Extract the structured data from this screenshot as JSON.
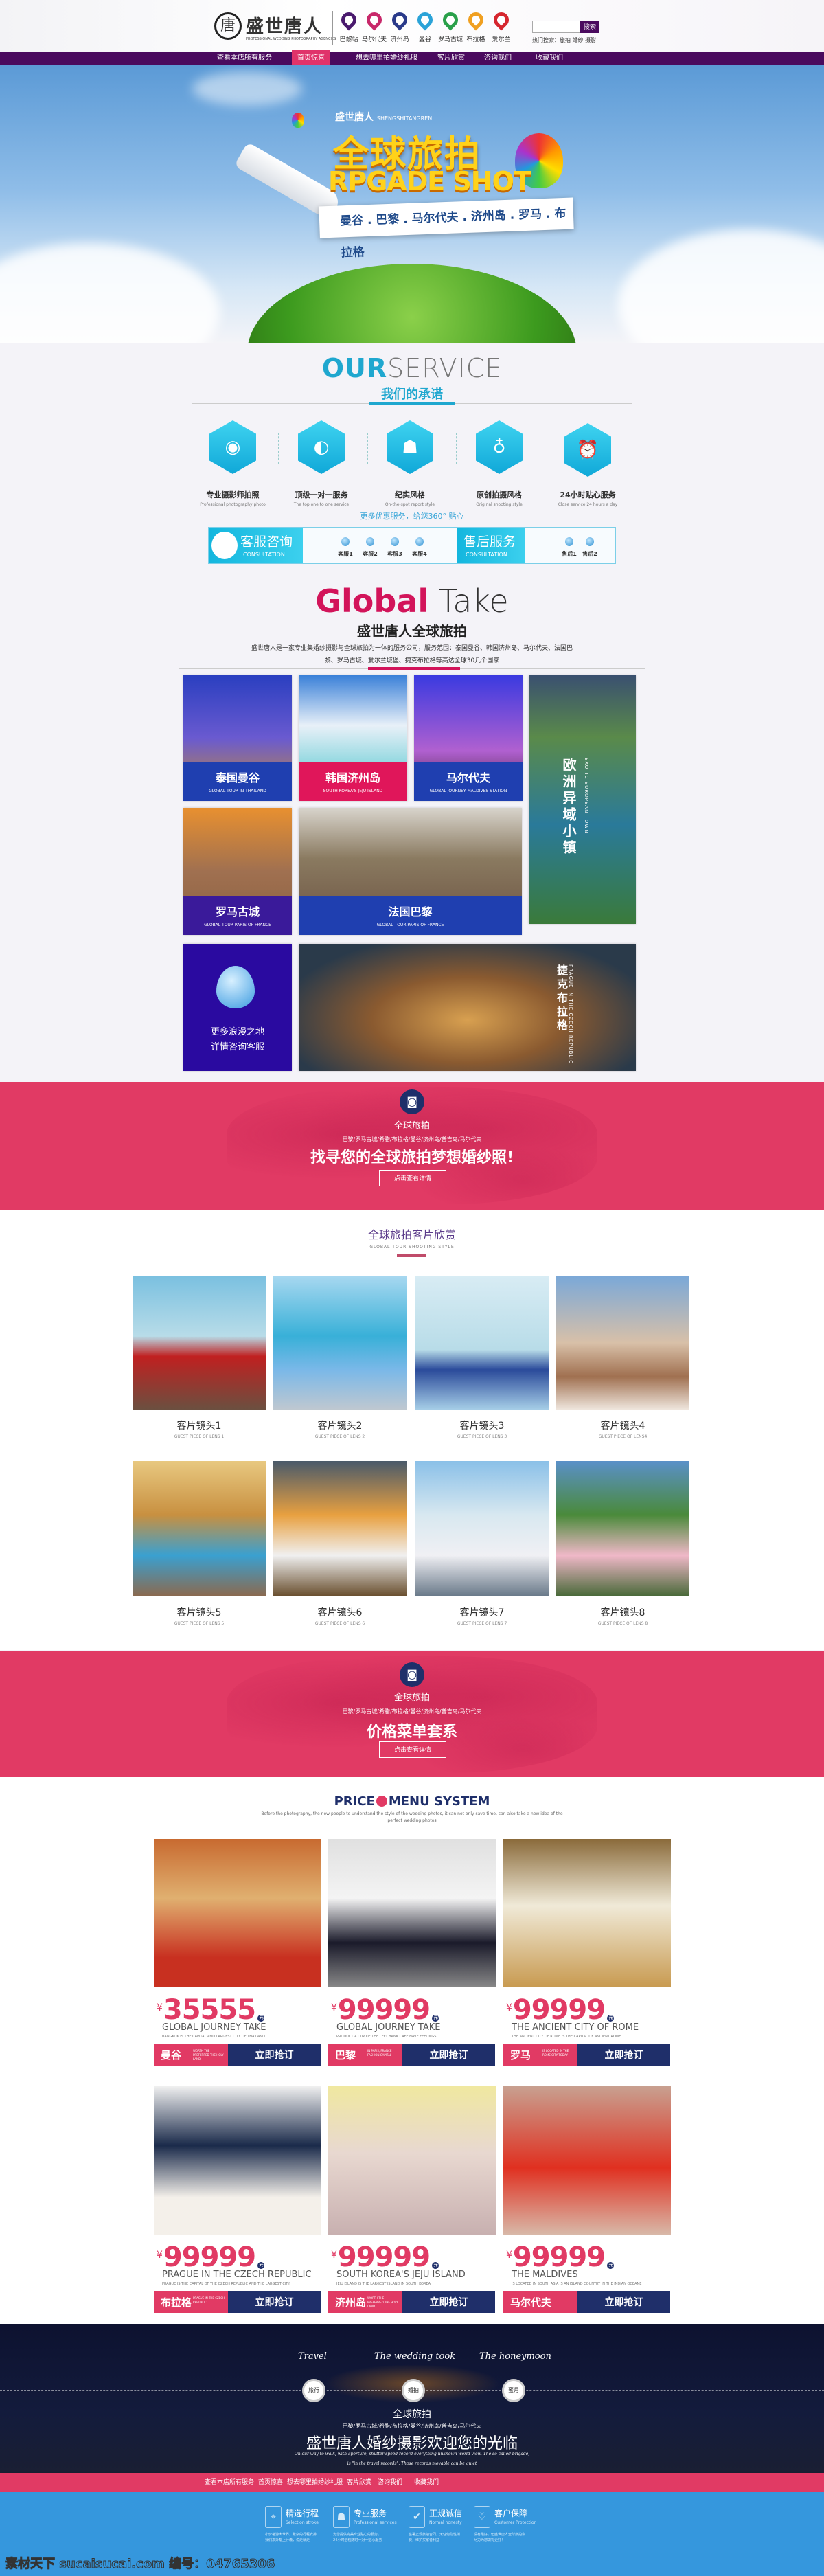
{
  "colors": {
    "brand_purple": "#4a0a5e",
    "accent_pink": "#e13a64",
    "navy": "#1f2f6a",
    "cyan": "#1fb8e0",
    "footer_blue": "#3597dd"
  },
  "header": {
    "logo_mark": "唐",
    "logo_text": "盛世唐人",
    "logo_sub": "PROFESSIONAL WEDDING PHOTOGRAPHY AGENCIES",
    "pins": [
      {
        "label": "巴黎站",
        "color": "#4a1a6e"
      },
      {
        "label": "马尔代夫",
        "color": "#c8286a"
      },
      {
        "label": "济州岛",
        "color": "#2a3a8a"
      },
      {
        "label": "曼谷",
        "color": "#2ba3d8"
      },
      {
        "label": "罗马古城",
        "color": "#2aa04a"
      },
      {
        "label": "布拉格",
        "color": "#f0a020"
      },
      {
        "label": "爱尔兰",
        "color": "#d6262e"
      }
    ],
    "search": {
      "value": "",
      "button": "搜索"
    },
    "hot_search": "热门搜索：旅拍  婚纱  摄影"
  },
  "nav": {
    "items": [
      "查看本店所有服务",
      "首页惊喜",
      "想去哪里拍婚纱礼服",
      "客片欣赏",
      "咨询我们",
      "收藏我们"
    ],
    "active": 1
  },
  "hero": {
    "brand": "盛世唐人",
    "brand_en": "SHENGSHITANGREN",
    "title": "全球旅拍",
    "title_en": "RPGADE SHOT",
    "destinations": "曼谷 . 巴黎 . 马尔代夫 . 济州岛 . 罗马 . 布拉格"
  },
  "service": {
    "title_bold": "OUR",
    "title_light": "SERVICE",
    "subtitle": "我们的承诺",
    "items": [
      {
        "icon": "camera",
        "label": "专业摄影师拍照",
        "en": "Professional photography photo"
      },
      {
        "icon": "hand-egg",
        "label": "顶级一对一服务",
        "en": "The top one to one service"
      },
      {
        "icon": "person-camera",
        "label": "纪实风格",
        "en": "On-the-spot report style"
      },
      {
        "icon": "lightbulb",
        "label": "原创拍摄风格",
        "en": "Original shooting style"
      },
      {
        "icon": "clock",
        "label": "24小时贴心服务",
        "en": "Close service 24 hours a day"
      }
    ],
    "more": "更多优惠服务，给您360° 贴心",
    "consult": {
      "title": "客服咨询",
      "en": "CONSULTATION",
      "agents": [
        "客服1",
        "客服2",
        "客服3",
        "客服4"
      ]
    },
    "after_sales": {
      "title": "售后服务",
      "en": "CONSULTATION",
      "agents": [
        "售后1",
        "售后2"
      ]
    }
  },
  "global": {
    "title_bold": "Global",
    "title_light": "Take",
    "subtitle": "盛世唐人全球旅拍",
    "desc": "盛世唐人是一家专业集婚纱摄影与全球旅拍为一体的服务公司，服务范围：泰国曼谷、韩国济州岛、马尔代夫、法国巴黎、罗马古城、爱尔兰城堡、捷克布拉格等高达全球30几个国家",
    "tiles": [
      {
        "zh": "泰国曼谷",
        "en": "GLOBAL TOUR IN THAILAND",
        "band": "#1f3fb0"
      },
      {
        "zh": "韩国济州岛",
        "en": "SOUTH KOREA'S JEJU ISLAND",
        "band": "#e0165a"
      },
      {
        "zh": "马尔代夫",
        "en": "GLOBAL JOURNEY MALDIVES STATION",
        "band": "#1f3fb0"
      },
      {
        "zh": "欧洲异域小镇",
        "en": "EXOTIC EUROPEAN TOWN"
      },
      {
        "zh": "罗马古城",
        "en": "GLOBAL TOUR PARIS OF FRANCE",
        "band": "#3a1a9a"
      },
      {
        "zh": "法国巴黎",
        "en": "GLOBAL TOUR PARIS OF FRANCE",
        "band": "#1f3fb0"
      },
      {
        "zh1": "更多浪漫之地",
        "zh2": "详情咨询客服"
      },
      {
        "zh": "捷克布拉格",
        "en": "PRAGUE IN THE CZECH REPUBLIC"
      }
    ]
  },
  "banner1": {
    "small": "全球旅拍",
    "cities": "巴黎/罗马古城/希腊/布拉格/曼谷/济州岛/普吉岛/马尔代夫",
    "big": "找寻您的全球旅拍梦想婚纱照!",
    "button": "点击查看详情"
  },
  "guest": {
    "title": "全球旅拍客片欣赏",
    "en": "GLOBAL TOUR SHOOTING STYLE",
    "items": [
      {
        "label": "客片镜头1",
        "en": "GUEST PIECE OF LENS 1"
      },
      {
        "label": "客片镜头2",
        "en": "GUEST PIECE OF LENS 2"
      },
      {
        "label": "客片镜头3",
        "en": "GUEST PIECE OF LENS 3"
      },
      {
        "label": "客片镜头4",
        "en": "GUEST PIECE OF LENS4"
      },
      {
        "label": "客片镜头5",
        "en": "GUEST PIECE OF LENS 5"
      },
      {
        "label": "客片镜头6",
        "en": "GUEST PIECE OF LENS 6"
      },
      {
        "label": "客片镜头7",
        "en": "GUEST PIECE OF LENS 7"
      },
      {
        "label": "客片镜头8",
        "en": "GUEST PIECE OF LENS 8"
      }
    ]
  },
  "banner2": {
    "small": "全球旅拍",
    "cities": "巴黎/罗马古城/希腊/布拉格/曼谷/济州岛/普吉岛/马尔代夫",
    "big": "价格菜单套系",
    "button": "点击查看详情"
  },
  "price": {
    "title_a": "PRICE",
    "title_b": "MENU SYSTEM",
    "desc": "Before the photography, the new people to understand the style of the wedding photos, it can not only save time, can also take a new idea of the perfect wedding photos",
    "currency": "¥",
    "unit": "元",
    "buy": "立即抢订",
    "items": [
      {
        "price": "35555",
        "name": "GLOBAL JOURNEY TAKE",
        "sub": "BANGKOK IS THE CAPITAL AND LARGEST CITY OF THAILAND",
        "tag": "曼谷",
        "tag_en": "WORTH THE PREFERRED THE HOLY LAND"
      },
      {
        "price": "99999",
        "name": "GLOBAL JOURNEY TAKE",
        "sub": "PRODUCT A CUP OF THE LEFT BANK CAFE HAVE FEELINGS",
        "tag": "巴黎",
        "tag_en": "IN PARIS, FRANCE FASHION CAPITAL"
      },
      {
        "price": "99999",
        "name": "THE ANCIENT CITY OF ROME",
        "sub": "THE ANCIENT CITY OF ROME IS THE CAPITAL OF ANCIENT ROME",
        "tag": "罗马",
        "tag_en": "IS LOCATED IN THE ROME CITY TODAY"
      },
      {
        "price": "99999",
        "name": "PRAGUE IN THE CZECH REPUBLIC",
        "sub": "PRAGUE IS THE CAPITAL OF THE CZECH REPUBLIC AND THE LARGEST CITY",
        "tag": "布拉格",
        "tag_en": "PRAGUE IN THE CZECH REPUBLIC"
      },
      {
        "price": "99999",
        "name": "SOUTH KOREA'S JEJU ISLAND",
        "sub": "JEJU ISLAND IS THE LARGEST ISLAND IN SOUTH KOREA",
        "tag": "济州岛",
        "tag_en": "WORTH THE PREFERRED THE HOLY LAND"
      },
      {
        "price": "99999",
        "name": "THE MALDIVES",
        "sub": "IS LOCATED IN SOUTH ASIA IS AN ISLAND COUNTRY IN THE INDIAN OCEANE",
        "tag": "马尔代夫",
        "tag_en": ""
      }
    ]
  },
  "night": {
    "steps": [
      {
        "en": "Travel",
        "zh": "旅行"
      },
      {
        "en": "The wedding took",
        "zh": "婚拍"
      },
      {
        "en": "The honeymoon",
        "zh": "蜜月"
      }
    ],
    "small": "全球旅拍",
    "cities": "巴黎/罗马古城/希腊/布拉格/曼谷/济州岛/普吉岛/马尔代夫",
    "big": "盛世唐人婚纱摄影欢迎您的光临",
    "line1": "On our way to walk, with aperture, shutter speed record everything unknown world view. The so-called brigade,",
    "line2": "is \"in the travel records\". Those records movable can be quiet"
  },
  "footer_nav": [
    "查看本店所有服务",
    "首页惊喜",
    "想去哪里拍婚纱礼服",
    "客片欣赏",
    "咨询我们",
    "收藏我们"
  ],
  "footer": {
    "items": [
      {
        "icon": "map-pin",
        "zh": "精选行程",
        "en": "Selection stroke",
        "desc": "小价格游大世界，繁杂的行程安排我们来办帮上行囊，说走就走"
      },
      {
        "icon": "person",
        "zh": "专业服务",
        "en": "Professional services",
        "desc": "为您提供完美专业贴心的服务，24小时全程随时一对一贴心服务"
      },
      {
        "icon": "check",
        "zh": "正规诚信",
        "en": "Normal honesty",
        "desc": "签署正规旅拍合同，无任何隐性消费，维护买家者利益"
      },
      {
        "icon": "heart",
        "zh": "客户保障",
        "en": "Customer Protection",
        "desc": "没有最好，但盛世唐人全球旅拍会尽力为您做得更好！"
      }
    ]
  },
  "watermark": "素材天下 sucaisucai.com  编号：04765306"
}
